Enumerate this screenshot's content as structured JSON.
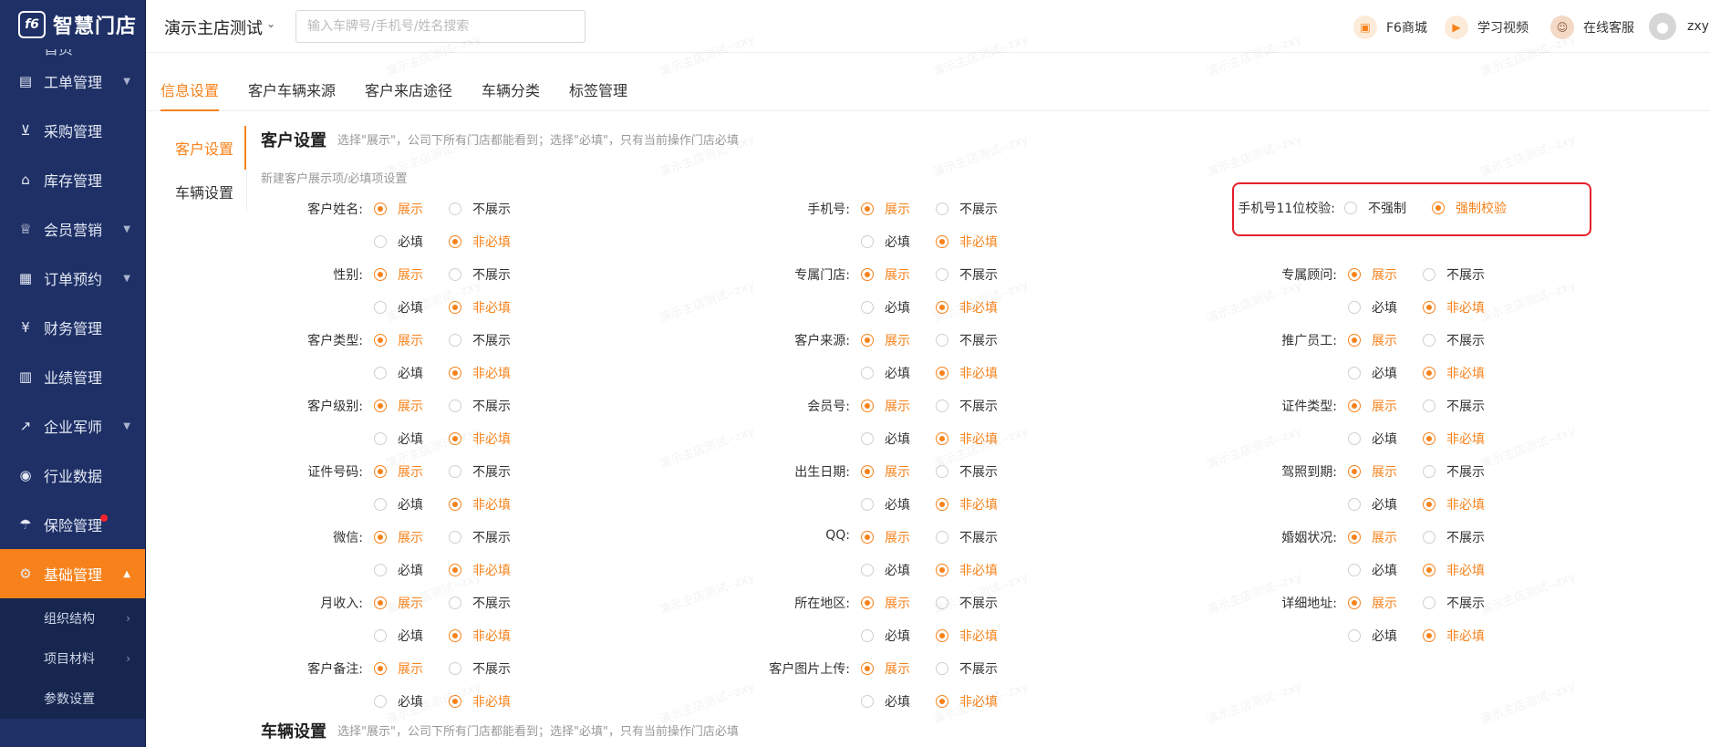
{
  "app": {
    "logo_mark": "f6",
    "logo_text": "智慧门店"
  },
  "sidebar": {
    "partial_item": "首页",
    "items": [
      {
        "label": "工单管理",
        "icon": "clipboard-icon",
        "glyph": "▤",
        "arrow": "▼"
      },
      {
        "label": "采购管理",
        "icon": "cart-icon",
        "glyph": "⊻",
        "arrow": ""
      },
      {
        "label": "库存管理",
        "icon": "warehouse-icon",
        "glyph": "⌂",
        "arrow": ""
      },
      {
        "label": "会员营销",
        "icon": "crown-icon",
        "glyph": "♕",
        "arrow": "▼"
      },
      {
        "label": "订单预约",
        "icon": "calendar-icon",
        "glyph": "▦",
        "arrow": "▼"
      },
      {
        "label": "财务管理",
        "icon": "yen-icon",
        "glyph": "¥",
        "arrow": ""
      },
      {
        "label": "业绩管理",
        "icon": "bar-chart-icon",
        "glyph": "▥",
        "arrow": ""
      },
      {
        "label": "企业军师",
        "icon": "trend-icon",
        "glyph": "↗",
        "arrow": "▼"
      },
      {
        "label": "行业数据",
        "icon": "check-circle-icon",
        "glyph": "◉",
        "arrow": ""
      },
      {
        "label": "保险管理",
        "icon": "umbrella-icon",
        "glyph": "☂",
        "arrow": ""
      },
      {
        "label": "基础管理",
        "icon": "gear-icon",
        "glyph": "⚙",
        "arrow": "▲"
      }
    ],
    "sub_items": [
      {
        "label": "组织结构",
        "arrow": "›"
      },
      {
        "label": "项目材料",
        "arrow": "›"
      },
      {
        "label": "参数设置",
        "arrow": ""
      }
    ]
  },
  "header": {
    "store_name": "演示主店测试",
    "store_caret": "⌄",
    "search_placeholder": "输入车牌号/手机号/姓名搜索",
    "links": {
      "mall": {
        "label": "F6商城",
        "glyph": "▣"
      },
      "video": {
        "label": "学习视频",
        "glyph": "▶"
      },
      "service": {
        "label": "在线客服",
        "glyph": "☺"
      },
      "user": {
        "label": "zxy",
        "glyph": "●"
      }
    }
  },
  "tabs": [
    "信息设置",
    "客户车辆来源",
    "客户来店途径",
    "车辆分类",
    "标签管理"
  ],
  "submenu": [
    "客户设置",
    "车辆设置"
  ],
  "customer_section": {
    "title": "客户设置",
    "hint": "选择\"展示\"，公司下所有门店都能看到；选择\"必填\"，只有当前操作门店必填",
    "sub_hint": "新建客户展示项/必填项设置"
  },
  "options": {
    "show": "展示",
    "hide": "不展示",
    "required": "必填",
    "optional": "非必填"
  },
  "fields": {
    "col1": [
      "客户姓名:",
      "性别:",
      "客户类型:",
      "客户级别:",
      "证件号码:",
      "微信:",
      "月收入:",
      "客户备注:"
    ],
    "col2": [
      "手机号:",
      "专属门店:",
      "客户来源:",
      "会员号:",
      "出生日期:",
      "QQ:",
      "所在地区:",
      "客户图片上传:"
    ],
    "col3": [
      "专属顾问:",
      "推广员工:",
      "证件类型:",
      "驾照到期:",
      "婚姻状况:",
      "详细地址:"
    ]
  },
  "phone_check": {
    "label": "手机号11位校验:",
    "option_no": "不强制",
    "option_yes": "强制校验"
  },
  "vehicle_section": {
    "title": "车辆设置",
    "hint": "选择\"展示\"，公司下所有门店都能看到；选择\"必填\"，只有当前操作门店必填"
  },
  "watermark": "演示主店测试--zxy",
  "colors": {
    "accent": "#f7821b",
    "sidebar": "#1e3066",
    "highlight": "#e5202a"
  }
}
